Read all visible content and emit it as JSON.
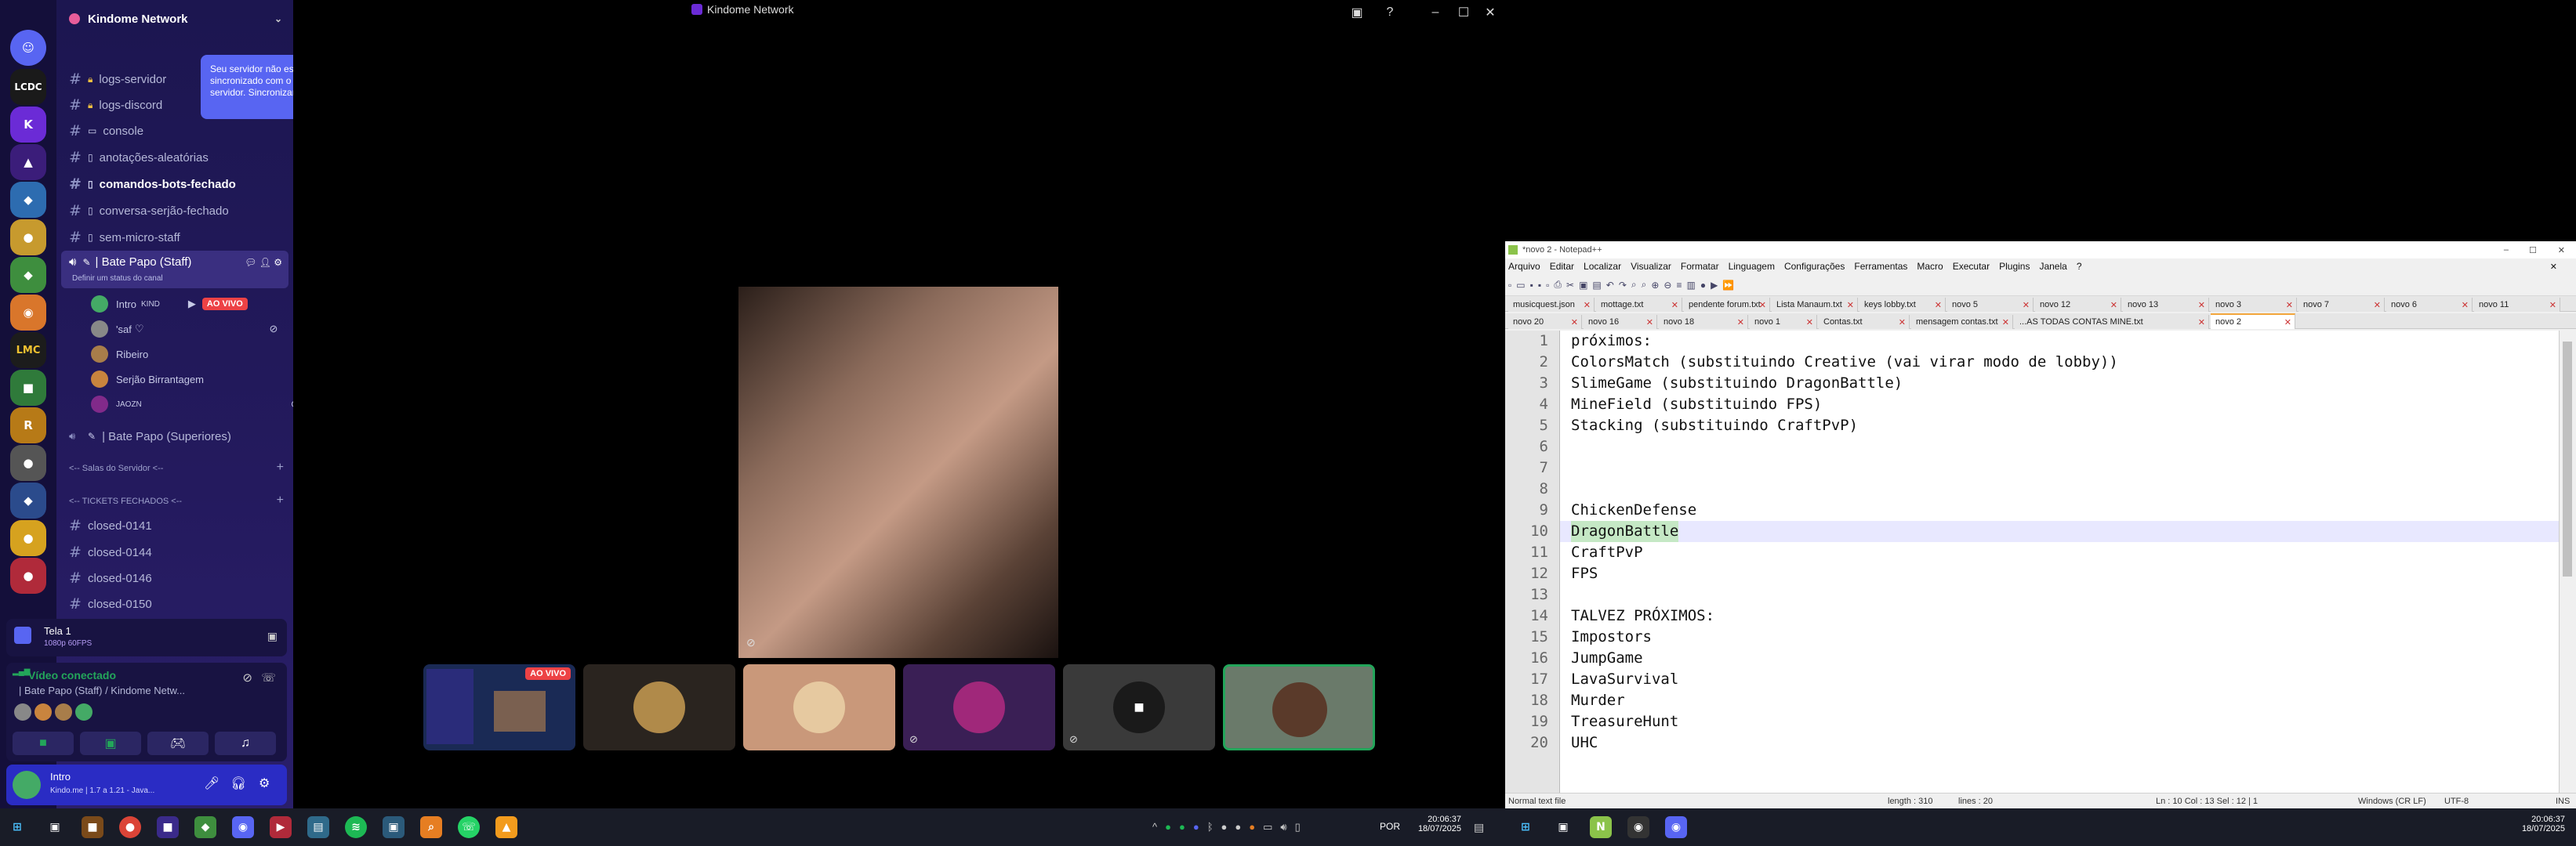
{
  "discord": {
    "window_title": "Kindome Network",
    "server_name": "Kindome Network",
    "tooltip": "Seu servidor não está sincronizado com o modelo do servidor. Sincronizar modelo?",
    "channels": [
      {
        "name": "logs-servidor",
        "icon": "lock-icon"
      },
      {
        "name": "logs-discord",
        "icon": "lock-icon"
      },
      {
        "name": "console",
        "icon": "monitor-icon"
      },
      {
        "name": "anotações-aleatórias",
        "icon": "page-icon"
      },
      {
        "name": "comandos-bots-fechado",
        "icon": "page-icon"
      },
      {
        "name": "conversa-serjão-fechado",
        "icon": "page-icon"
      },
      {
        "name": "sem-micro-staff",
        "icon": "page-icon"
      }
    ],
    "voice_channel": {
      "name": "| Bate Papo (Staff)",
      "status_placeholder": "Definir um status do canal",
      "users": [
        {
          "name": "Intro",
          "tag": "KIND",
          "live": "AO VIVO"
        },
        {
          "name": "'saf",
          "tag": "♡"
        },
        {
          "name": "Ribeiro"
        },
        {
          "name": "Serjão Birrantagem"
        },
        {
          "name": "JAOZN"
        }
      ]
    },
    "voice_channel_2": "| Bate Papo (Superiores)",
    "category_1": "<-- Salas do Servidor <--",
    "category_2": "<-- TICKETS FECHADOS <--",
    "tickets": [
      "closed-0141",
      "closed-0144",
      "closed-0146",
      "closed-0150"
    ],
    "screen_share": {
      "title": "Tela 1",
      "quality": "1080p 60FPS"
    },
    "voice_status": {
      "title": "Vídeo conectado",
      "channel": "| Bate Papo (Staff) / Kindome Netw..."
    },
    "user_panel": {
      "name": "Intro",
      "status": "Kindo.me | 1.7 a 1.21 - Java..."
    },
    "live_badge": "AO VIVO",
    "guild_labels": [
      "LCDC",
      "LMC",
      "R"
    ]
  },
  "notepad": {
    "title": "*novo 2 - Notepad++",
    "menu": [
      "Arquivo",
      "Editar",
      "Localizar",
      "Visualizar",
      "Formatar",
      "Linguagem",
      "Configurações",
      "Ferramentas",
      "Macro",
      "Executar",
      "Plugins",
      "Janela",
      "?"
    ],
    "tabs_row1": [
      "musicquest.json",
      "mottage.txt",
      "pendente forum.txt",
      "Lista Manaum.txt",
      "keys lobby.txt",
      "novo 5",
      "novo 12",
      "novo 13",
      "novo 3",
      "novo 7",
      "novo 6",
      "novo 11"
    ],
    "tabs_row2": [
      "novo 20",
      "novo 16",
      "novo 18",
      "novo 1",
      "Contas.txt",
      "mensagem contas.txt",
      "...AS TODAS CONTAS MINE.txt",
      "novo 2"
    ],
    "lines": [
      "próximos:",
      "ColorsMatch (substituindo Creative (vai virar modo de lobby))",
      "SlimeGame (substituindo DragonBattle)",
      "MineField (substituindo FPS)",
      "Stacking (substituindo CraftPvP)",
      "",
      "",
      "",
      "ChickenDefense",
      "DragonBattle",
      "CraftPvP",
      "FPS",
      "",
      "TALVEZ PRÓXIMOS:",
      "Impostors",
      "JumpGame",
      "LavaSurvival",
      "Murder",
      "TreasureHunt",
      "UHC"
    ],
    "line_numbers": [
      "1",
      "2",
      "3",
      "4",
      "5",
      "6",
      "7",
      "8",
      "9",
      "10",
      "11",
      "12",
      "13",
      "14",
      "15",
      "16",
      "17",
      "18",
      "19",
      "20"
    ],
    "status": {
      "file_type": "Normal text file",
      "length": "length : 310",
      "lines": "lines : 20",
      "position": "Ln : 10    Col : 13    Sel : 12 | 1",
      "eol": "Windows (CR LF)",
      "encoding": "UTF-8",
      "mode": "INS"
    }
  },
  "taskbar": {
    "language": "POR",
    "time": "20:06:37",
    "date": "18/07/2025"
  }
}
